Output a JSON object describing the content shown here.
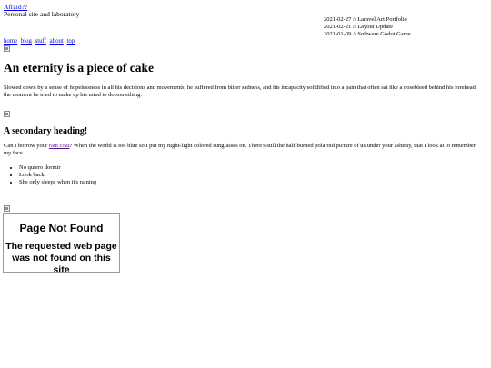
{
  "site": {
    "title": "Afraid??",
    "tagline": "Personal site and laboratory"
  },
  "recent_posts": [
    {
      "text": "2021-02-27 // Laravel Art Portfolio"
    },
    {
      "text": "2021-02-21 // Layout Update"
    },
    {
      "text": "2021-01-09 // Software Godot Game"
    }
  ],
  "nav": [
    {
      "label": "home"
    },
    {
      "label": "blog"
    },
    {
      "label": "stuff"
    },
    {
      "label": "about"
    },
    {
      "label": "top"
    }
  ],
  "article": {
    "heading": "An eternity is a piece of cake",
    "paragraph1": "Slowed down by a sense of hopelessness in all his decisions and movements, he suffered from bitter sadness, and his incapacity solidified into a pain that often sat like a nosebleed behind his forehead the moment he tried to make up his mind to do something.",
    "subheading": "A secondary heading!",
    "paragraph2_before": "Can I borrow your ",
    "paragraph2_link": "rain coat",
    "paragraph2_after": "? When the world is too blue so I put my night-light colored sunglasses on. There's still the half-burned polaroid picture of us under your ashtray, that I look at to remember my face.",
    "list": [
      "No quiero dormir",
      "Look back",
      "She only sleeps when it's raining"
    ]
  },
  "embed": {
    "title": "Page Not Found",
    "text": "The requested web page was not found on this site"
  }
}
